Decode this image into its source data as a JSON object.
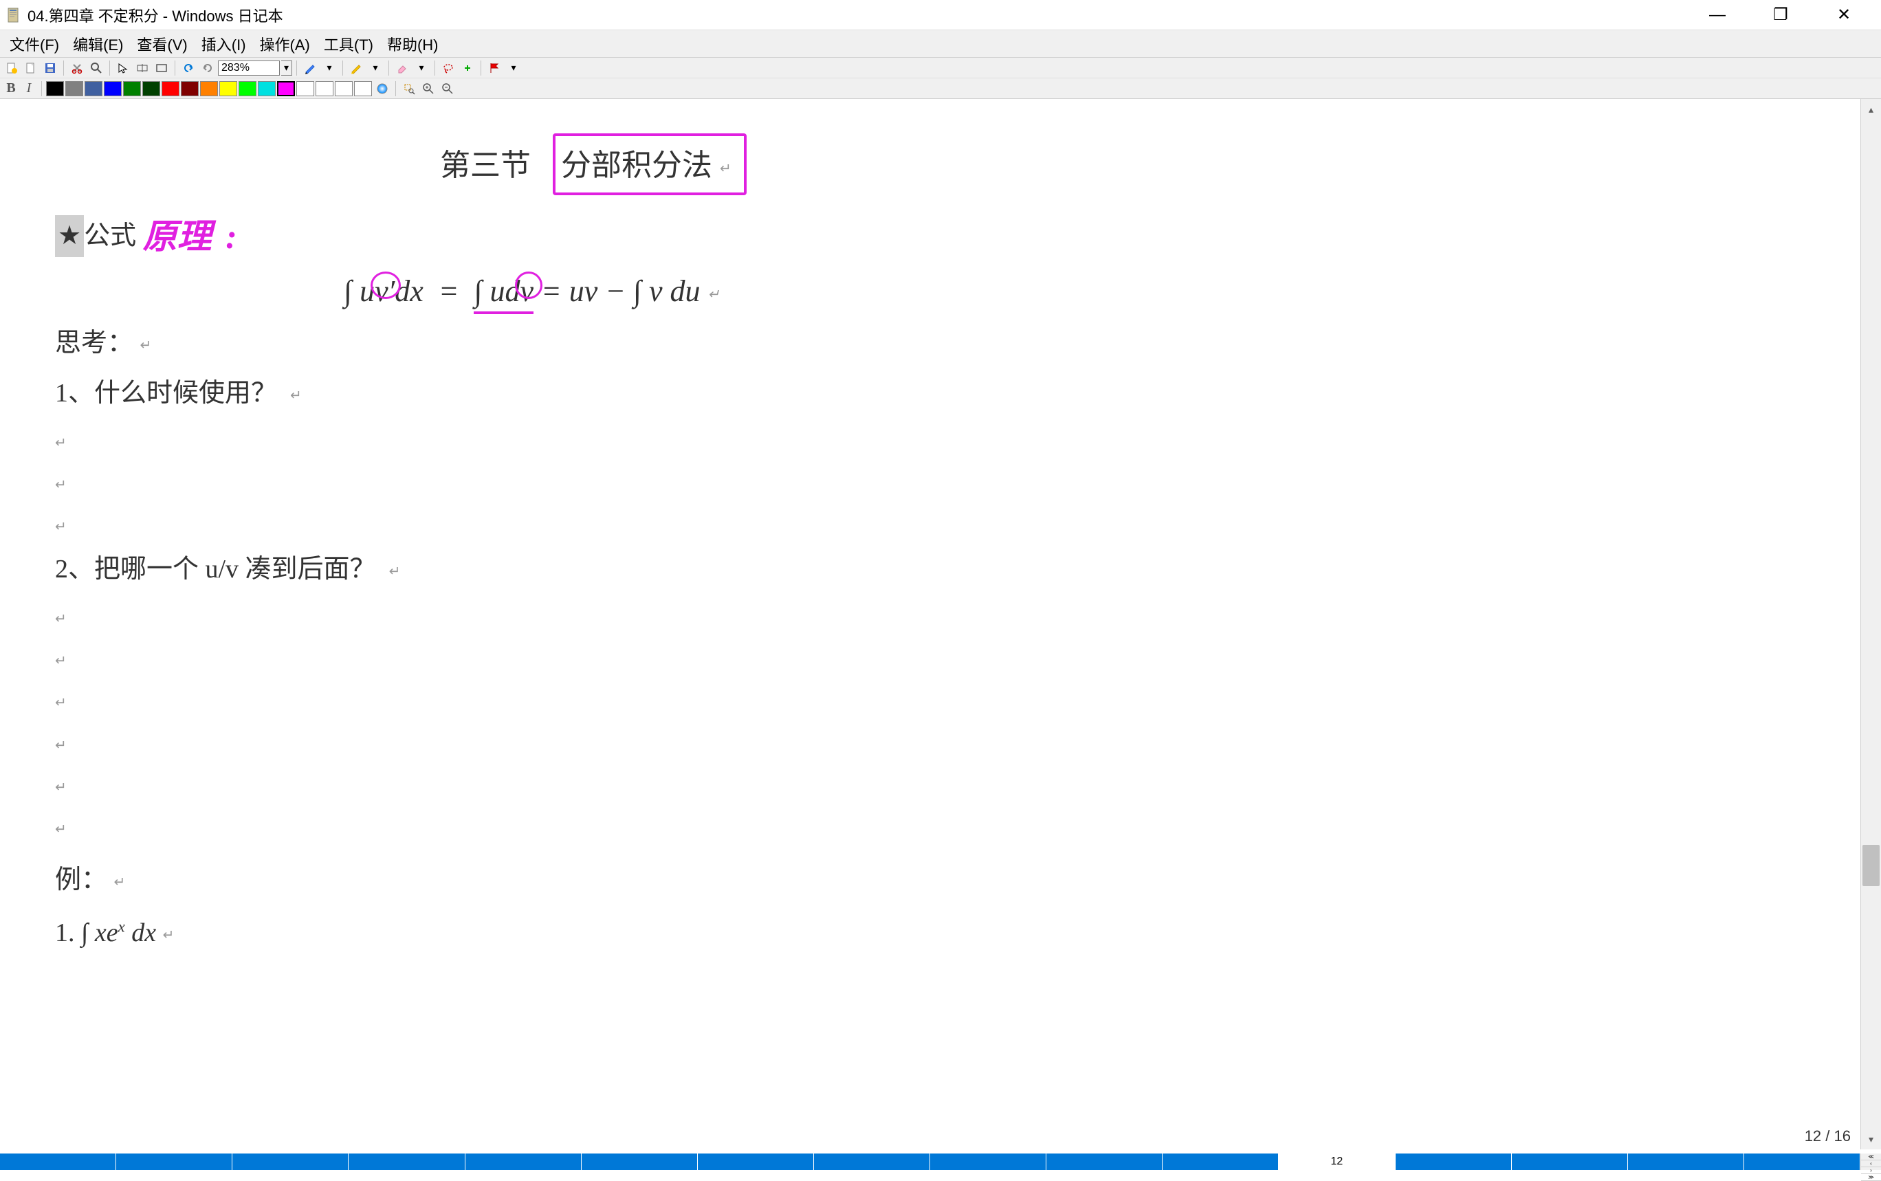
{
  "window": {
    "title": "04.第四章 不定积分 - Windows 日记本",
    "minimize": "—",
    "maximize": "❐",
    "close": "✕"
  },
  "menu": {
    "file": "文件(F)",
    "edit": "编辑(E)",
    "view": "查看(V)",
    "insert": "插入(I)",
    "actions": "操作(A)",
    "tools": "工具(T)",
    "help": "帮助(H)"
  },
  "toolbar": {
    "zoom": "283%",
    "bold": "B",
    "italic": "I"
  },
  "colors": {
    "black": "#000000",
    "gray": "#808080",
    "darkred": "#800000",
    "blue": "#0000ff",
    "green": "#008000",
    "darkgreen": "#004000",
    "red": "#ff0000",
    "darkblue": "#000080",
    "orange": "#ff8000",
    "yellow": "#ffff00",
    "lime": "#00ff00",
    "cyan": "#00ffff",
    "magenta": "#ff00ff",
    "white1": "#ffffff",
    "white2": "#ffffff",
    "white3": "#ffffff",
    "white4": "#ffffff"
  },
  "content": {
    "section_label": "第三节",
    "section_title": "分部积分法",
    "para_mark": "↵",
    "star": "★",
    "formula_label": "公式",
    "handwritten_note": "原理",
    "handwritten_colon": ":",
    "formula": "∫ uv′dx = ∫ udv = uv − ∫ v du",
    "think_label": "思考：",
    "q1": "1、什么时候使用？",
    "q2": "2、把哪一个 u/v 凑到后面？",
    "example_label": "例：",
    "example1_num": "1. ",
    "example1_formula": "∫ xeˣ dx"
  },
  "status": {
    "current_page": "12",
    "total_pages": "16",
    "sep": " / "
  }
}
